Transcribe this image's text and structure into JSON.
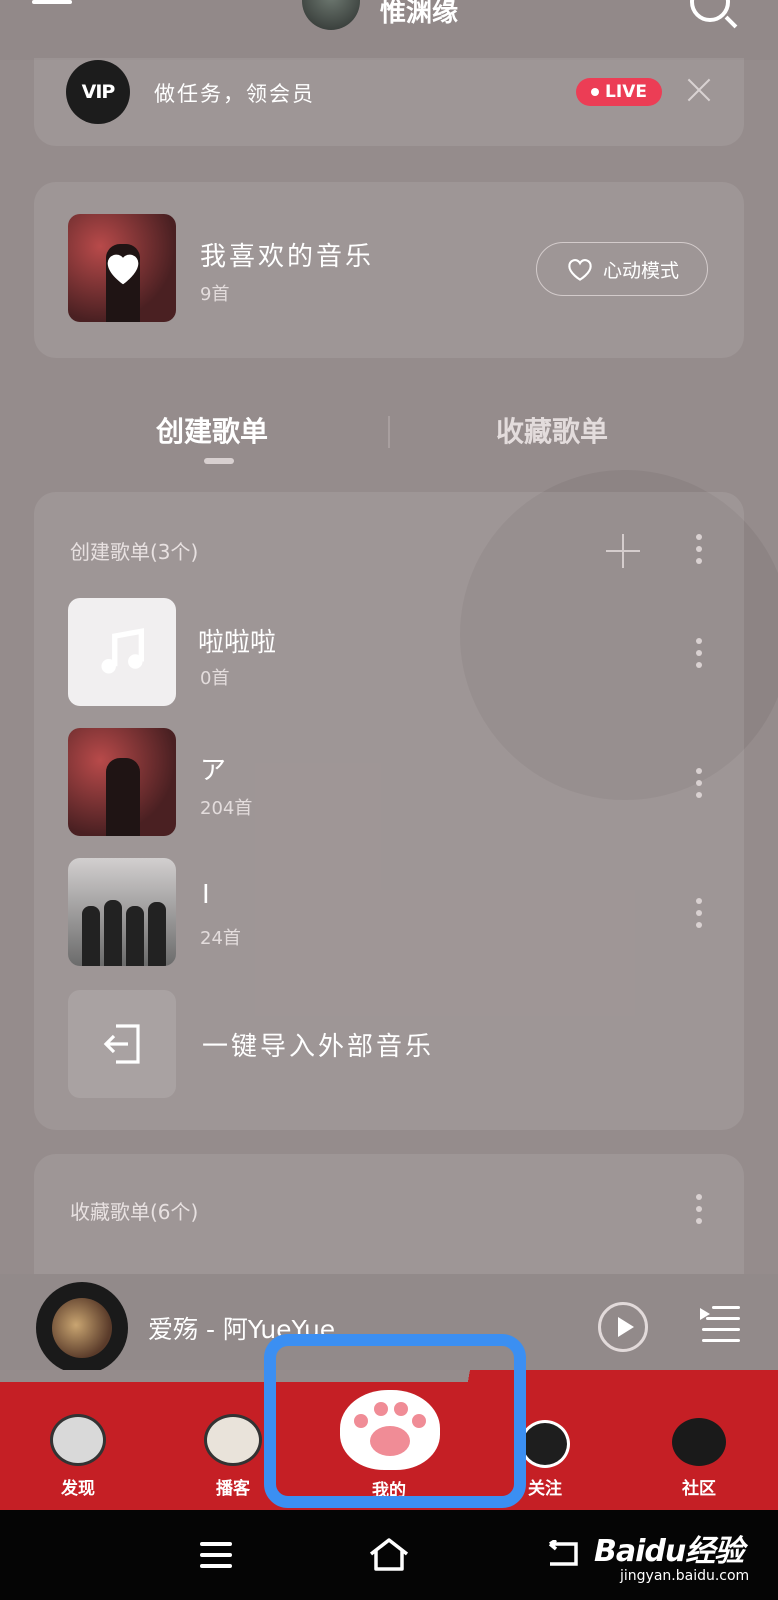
{
  "header": {
    "username": "惟渊缘",
    "menu_icon": "hamburger-icon",
    "search_icon": "search-icon"
  },
  "vip_banner": {
    "logo_text": "VIP",
    "text": "做任务，领会员",
    "live_badge": "LIVE"
  },
  "liked_music": {
    "title": "我喜欢的音乐",
    "count": "9首",
    "heartbeat_label": "心动模式"
  },
  "tabs": [
    {
      "label": "创建歌单",
      "active": true
    },
    {
      "label": "收藏歌单",
      "active": false
    }
  ],
  "created_section": {
    "header": "创建歌单(3个)",
    "playlists": [
      {
        "title": "啦啦啦",
        "count": "0首"
      },
      {
        "title": "ア",
        "count": "204首"
      },
      {
        "title": "I",
        "count": "24首"
      }
    ],
    "import_label": "一键导入外部音乐"
  },
  "collected_section": {
    "header": "收藏歌单(6个)"
  },
  "player": {
    "song": "爱殇 - 阿YueYue"
  },
  "nav": [
    {
      "label": "发现"
    },
    {
      "label": "播客"
    },
    {
      "label": "我的"
    },
    {
      "label": "关注"
    },
    {
      "label": "社区"
    }
  ],
  "watermark": {
    "brand": "Baidu经验",
    "url": "jingyan.baidu.com"
  },
  "colors": {
    "accent_red": "#c51f25",
    "live_red": "#ec3d55",
    "highlight_blue": "#3b8ff2",
    "background": "#958c8c"
  }
}
